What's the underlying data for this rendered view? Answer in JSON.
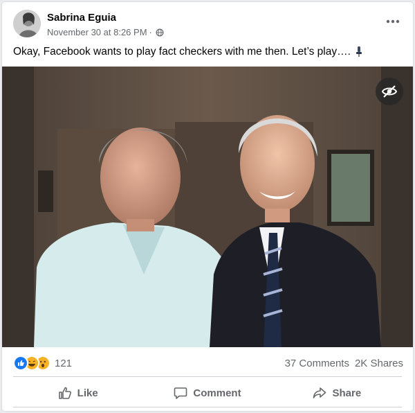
{
  "post": {
    "author": "Sabrina Eguia",
    "timestamp": "November 30 at 8:26 PM",
    "separator": "·",
    "privacy_icon": "globe-icon",
    "more_icon": "more-options-icon",
    "caption": "Okay, Facebook wants to play fact checkers with me then. Let’s play…."
  },
  "image": {
    "overlay_icon": "eye-slash-icon"
  },
  "stats": {
    "reaction_icons": [
      "like-reaction-icon",
      "haha-reaction-icon",
      "wow-reaction-icon"
    ],
    "reaction_count": "121",
    "comments": "37 Comments",
    "shares": "2K Shares"
  },
  "actions": {
    "like": "Like",
    "comment": "Comment",
    "share": "Share"
  },
  "colors": {
    "text_primary": "#050505",
    "text_secondary": "#65676b",
    "divider": "#ced0d4",
    "like_blue": "#1877f2",
    "reaction_yellow": "#f7b125"
  }
}
